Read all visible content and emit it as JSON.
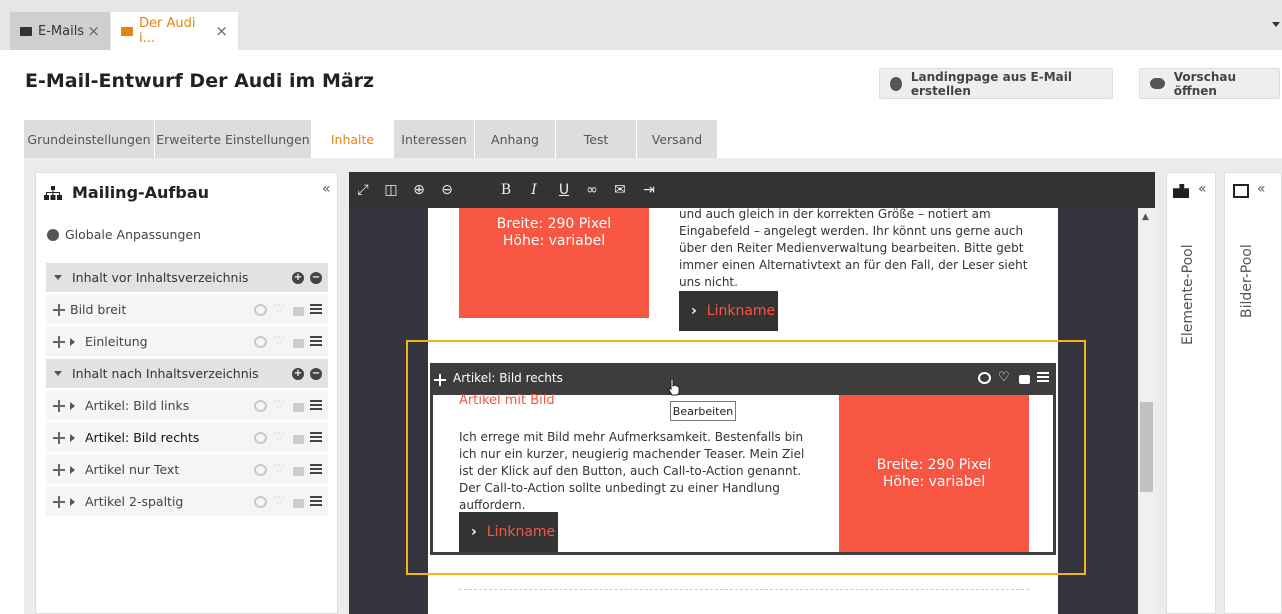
{
  "window_tabs": [
    {
      "label": "E-Mails"
    },
    {
      "label": "Der Audi i..."
    }
  ],
  "page_title": "E-Mail-Entwurf Der Audi im März",
  "header_buttons": {
    "landing": "Landingpage aus E-Mail erstellen",
    "preview": "Vorschau öffnen"
  },
  "settings_tabs": [
    {
      "label": "Grundeinstellungen"
    },
    {
      "label": "Erweiterte Einstellungen"
    },
    {
      "label": "Inhalte"
    },
    {
      "label": "Interessen"
    },
    {
      "label": "Anhang"
    },
    {
      "label": "Test"
    },
    {
      "label": "Versand"
    }
  ],
  "left_panel": {
    "title": "Mailing-Aufbau",
    "collapse": "«",
    "global": "Globale Anpassungen",
    "rows": [
      {
        "label": "Inhalt vor Inhaltsverzeichnis"
      },
      {
        "label": "Bild breit"
      },
      {
        "label": "Einleitung"
      },
      {
        "label": "Inhalt nach Inhaltsverzeichnis"
      },
      {
        "label": "Artikel: Bild links"
      },
      {
        "label": "Artikel: Bild rechts"
      },
      {
        "label": "Artikel nur Text"
      },
      {
        "label": "Artikel 2-spaltig"
      }
    ]
  },
  "toolbar": {
    "bold": "B",
    "italic": "I",
    "underline": "U"
  },
  "content": {
    "img1_line1": "Breite: 290 Pixel",
    "img1_line2": "Höhe: variabel",
    "text1": "und auch gleich in der korrekten Größe – notiert am Eingabefeld – angelegt werden. Ihr könnt uns gerne auch über den Reiter Medienverwaltung bearbeiten. Bitte gebt immer einen Alternativtext an für den Fall, der Leser sieht uns nicht.",
    "link1": "Linkname",
    "article_label": "Artikel: Bild rechts",
    "article_heading": "Artikel mit Bild",
    "article_text": "Ich errege mit Bild mehr Aufmerksamkeit. Bestenfalls bin ich nur ein kurzer, neugierig machender Teaser. Mein Ziel ist der Klick auf den Button, auch Call-to-Action genannt. Der Call-to-Action sollte unbedingt zu einer Handlung auffordern.",
    "link2": "Linkname",
    "img2_line1": "Breite: 290 Pixel",
    "img2_line2": "Höhe: variabel",
    "tooltip": "Bearbeiten"
  },
  "pools": {
    "elements": "Elemente-Pool",
    "images": "Bilder-Pool",
    "collapse": "«"
  },
  "colors": {
    "accent": "#e8830c",
    "placeholder": "#f65642",
    "highlight": "#f2b51d",
    "editor_bg": "#353540"
  }
}
